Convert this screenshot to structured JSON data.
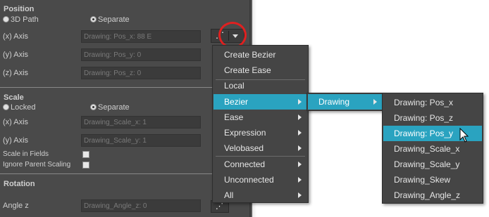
{
  "position": {
    "title": "Position",
    "radio_3d": "3D Path",
    "radio_separate": "Separate",
    "x_label": "(x) Axis",
    "x_value": "Drawing: Pos_x: 88 E",
    "y_label": "(y) Axis",
    "y_value": "Drawing: Pos_y: 0",
    "z_label": "(z) Axis",
    "z_value": "Drawing: Pos_z: 0"
  },
  "scale": {
    "title": "Scale",
    "radio_locked": "Locked",
    "radio_separate": "Separate",
    "x_label": "(x) Axis",
    "x_value": "Drawing_Scale_x: 1",
    "y_label": "(y) Axis",
    "y_value": "Drawing_Scale_y: 1",
    "scale_in_fields": "Scale in Fields",
    "ignore_parent": "Ignore Parent Scaling"
  },
  "rotation": {
    "title": "Rotation",
    "angle_label": "Angle z",
    "angle_value": "Drawing_Angle_z: 0"
  },
  "context_menu": {
    "items": [
      {
        "label": "Create Bezier"
      },
      {
        "label": "Create Ease"
      },
      {
        "label": "Local"
      },
      {
        "label": "Bezier"
      },
      {
        "label": "Ease"
      },
      {
        "label": "Expression"
      },
      {
        "label": "Velobased"
      },
      {
        "label": "Connected"
      },
      {
        "label": "Unconnected"
      },
      {
        "label": "All"
      }
    ]
  },
  "bezier_submenu": {
    "items": [
      {
        "label": "Drawing"
      }
    ]
  },
  "drawing_submenu": {
    "items": [
      {
        "label": "Drawing: Pos_x"
      },
      {
        "label": "Drawing: Pos_z"
      },
      {
        "label": "Drawing: Pos_y"
      },
      {
        "label": "Drawing_Scale_x"
      },
      {
        "label": "Drawing_Scale_y"
      },
      {
        "label": "Drawing_Skew"
      },
      {
        "label": "Drawing_Angle_z"
      }
    ]
  },
  "colors": {
    "panel_bg": "#4a4a4a",
    "menu_bg": "#454545",
    "highlight": "#2aa3c0",
    "annotation_circle": "#e02020"
  }
}
